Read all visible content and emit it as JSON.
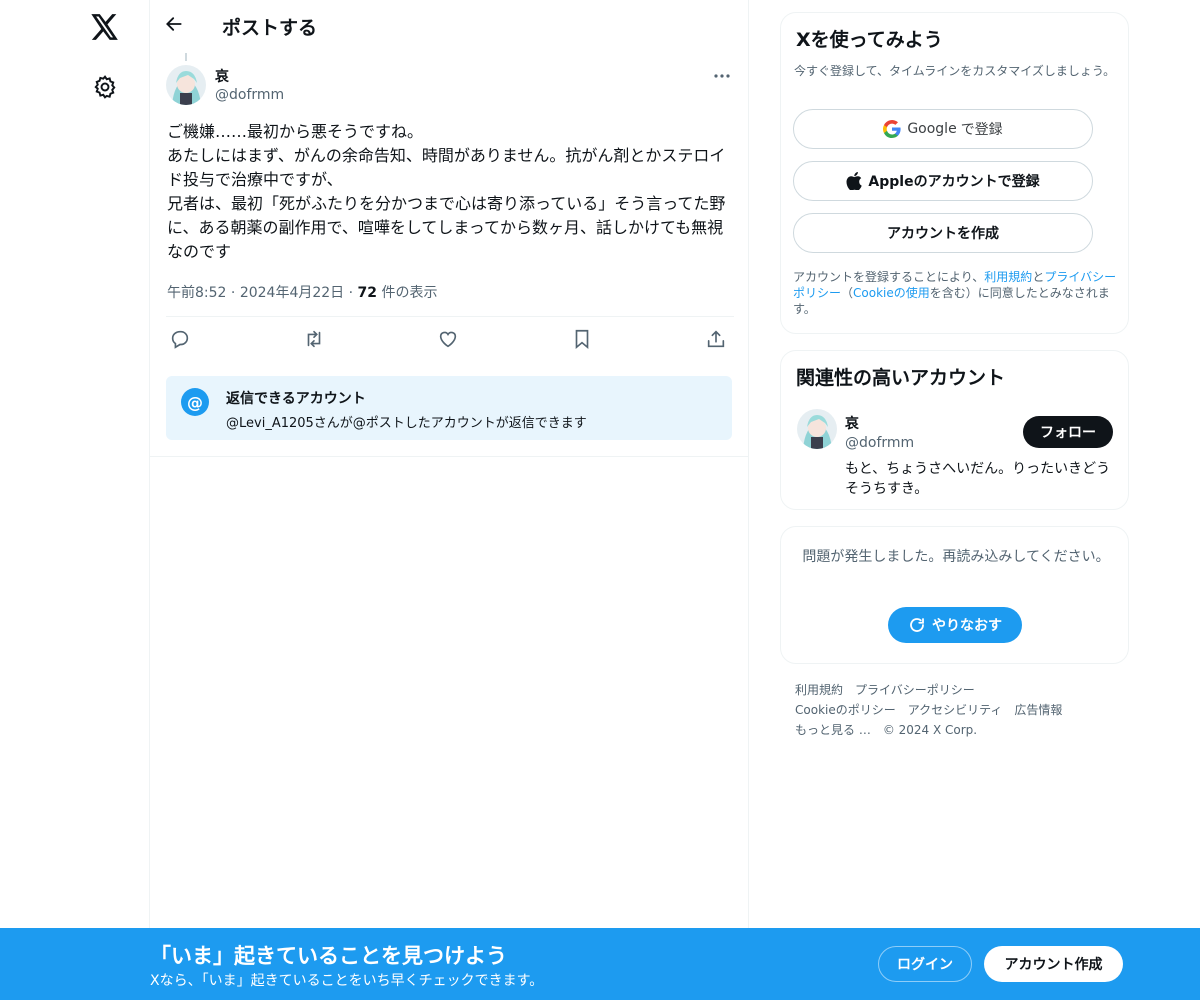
{
  "header": {
    "title": "ポストする"
  },
  "post": {
    "display_name": "哀",
    "handle": "@dofrmm",
    "lines": [
      "ご機嫌……最初から悪そうですね。",
      "あたしにはまず、がんの余命告知、時間がありません。抗がん剤とかステロイド投与で治療中ですが、",
      "兄者は、最初「死がふたりを分かつまで心は寄り添っている」そう言ってた野に、ある朝薬の副作用で、喧嘩をしてしまってから数ヶ月、話しかけても無視なのです"
    ],
    "time": "午前8:52",
    "date": "2024年4月22日",
    "view_count": "72",
    "view_label": "件の表示"
  },
  "reply_restriction": {
    "title": "返信できるアカウント",
    "subtitle": "@Levi_A1205さんが@ポストしたアカウントが返信できます"
  },
  "signup": {
    "title": "Xを使ってみよう",
    "subtitle": "今すぐ登録して、タイムラインをカスタマイズしましょう。",
    "google_brand": "Google",
    "google_label": "で登録",
    "apple_label": "Appleのアカウントで登録",
    "create_label": "アカウントを作成",
    "terms_prefix": "アカウントを登録することにより、",
    "terms_link": "利用規約",
    "terms_and": "と",
    "privacy_link": "プライバシーポリシー",
    "terms_paren_open": "（",
    "cookie_link": "Cookieの使用",
    "terms_suffix": "を含む）に同意したとみなされます。"
  },
  "related": {
    "title": "関連性の高いアカウント",
    "name": "哀",
    "handle": "@dofrmm",
    "follow_label": "フォロー",
    "bio": "もと、ちょうさへいだん。りったいきどうそうちすき。"
  },
  "error": {
    "message": "問題が発生しました。再読み込みしてください。",
    "retry_label": "やりなおす"
  },
  "footer": {
    "links": [
      "利用規約",
      "プライバシーポリシー",
      "Cookieのポリシー",
      "アクセシビリティ",
      "広告情報",
      "もっと見る …"
    ],
    "copyright": "© 2024 X Corp."
  },
  "banner": {
    "title": "「いま」起きていることを見つけよう",
    "subtitle": "Xなら、「いま」起きていることをいち早くチェックできます。",
    "login_label": "ログイン",
    "create_label": "アカウント作成"
  },
  "colors": {
    "accent": "#1d9bf0",
    "text": "#0f1419",
    "muted": "#536471"
  }
}
